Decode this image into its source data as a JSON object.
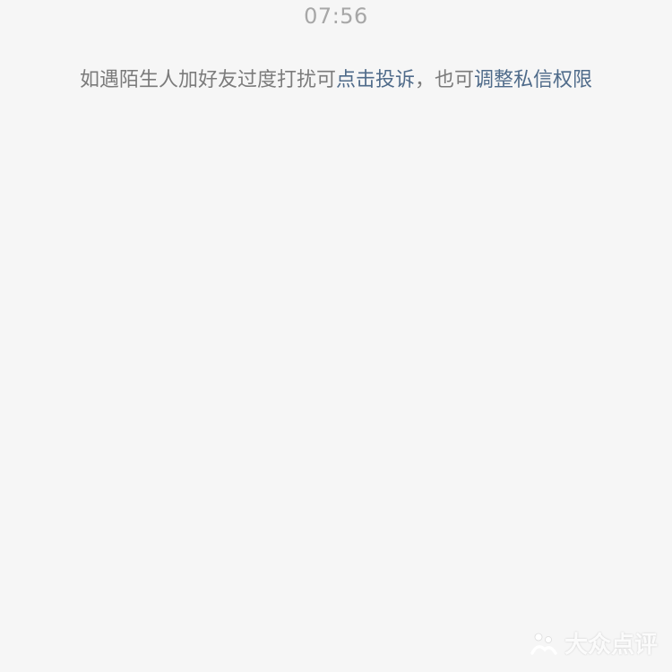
{
  "chat": {
    "timestamp": "07:56",
    "notice": {
      "prefix": "如遇陌生人加好友过度打扰可",
      "report_link": "点击投诉",
      "middle": "，也可",
      "privacy_link": "调整私信权限"
    }
  },
  "watermark": {
    "icon": "dianping-logo-icon",
    "text": "大众点评"
  }
}
